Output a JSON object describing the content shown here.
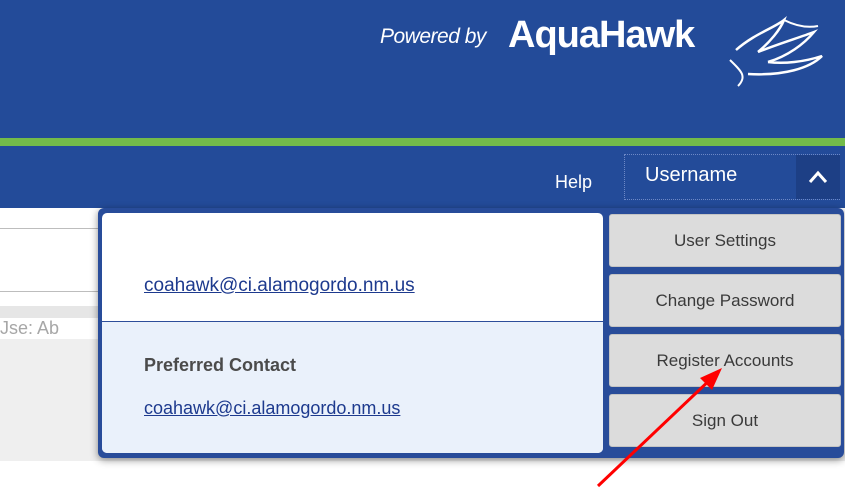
{
  "header": {
    "logo": {
      "powered_by": "Powered by",
      "brand": "AquaHawk",
      "icon": "hawk-logo-icon"
    }
  },
  "nav": {
    "help_label": "Help",
    "user_menu": {
      "label": "Username",
      "icon": "chevron-up-icon"
    }
  },
  "background": {
    "partial_text": "Jse: Ab"
  },
  "dropdown": {
    "email": "coahawk@ci.alamogordo.nm.us",
    "preferred_contact_label": "Preferred Contact",
    "preferred_contact_email": "coahawk@ci.alamogordo.nm.us",
    "menu_items": [
      "User Settings",
      "Change Password",
      "Register Accounts",
      "Sign Out"
    ]
  },
  "annotation": {
    "color": "#ff0000",
    "icon": "red-arrow-annotation"
  },
  "colors": {
    "header_bg": "#234b99",
    "accent_green": "#73bb4a",
    "menu_btn": "#dcdcdc",
    "link": "#1d3a8e"
  }
}
